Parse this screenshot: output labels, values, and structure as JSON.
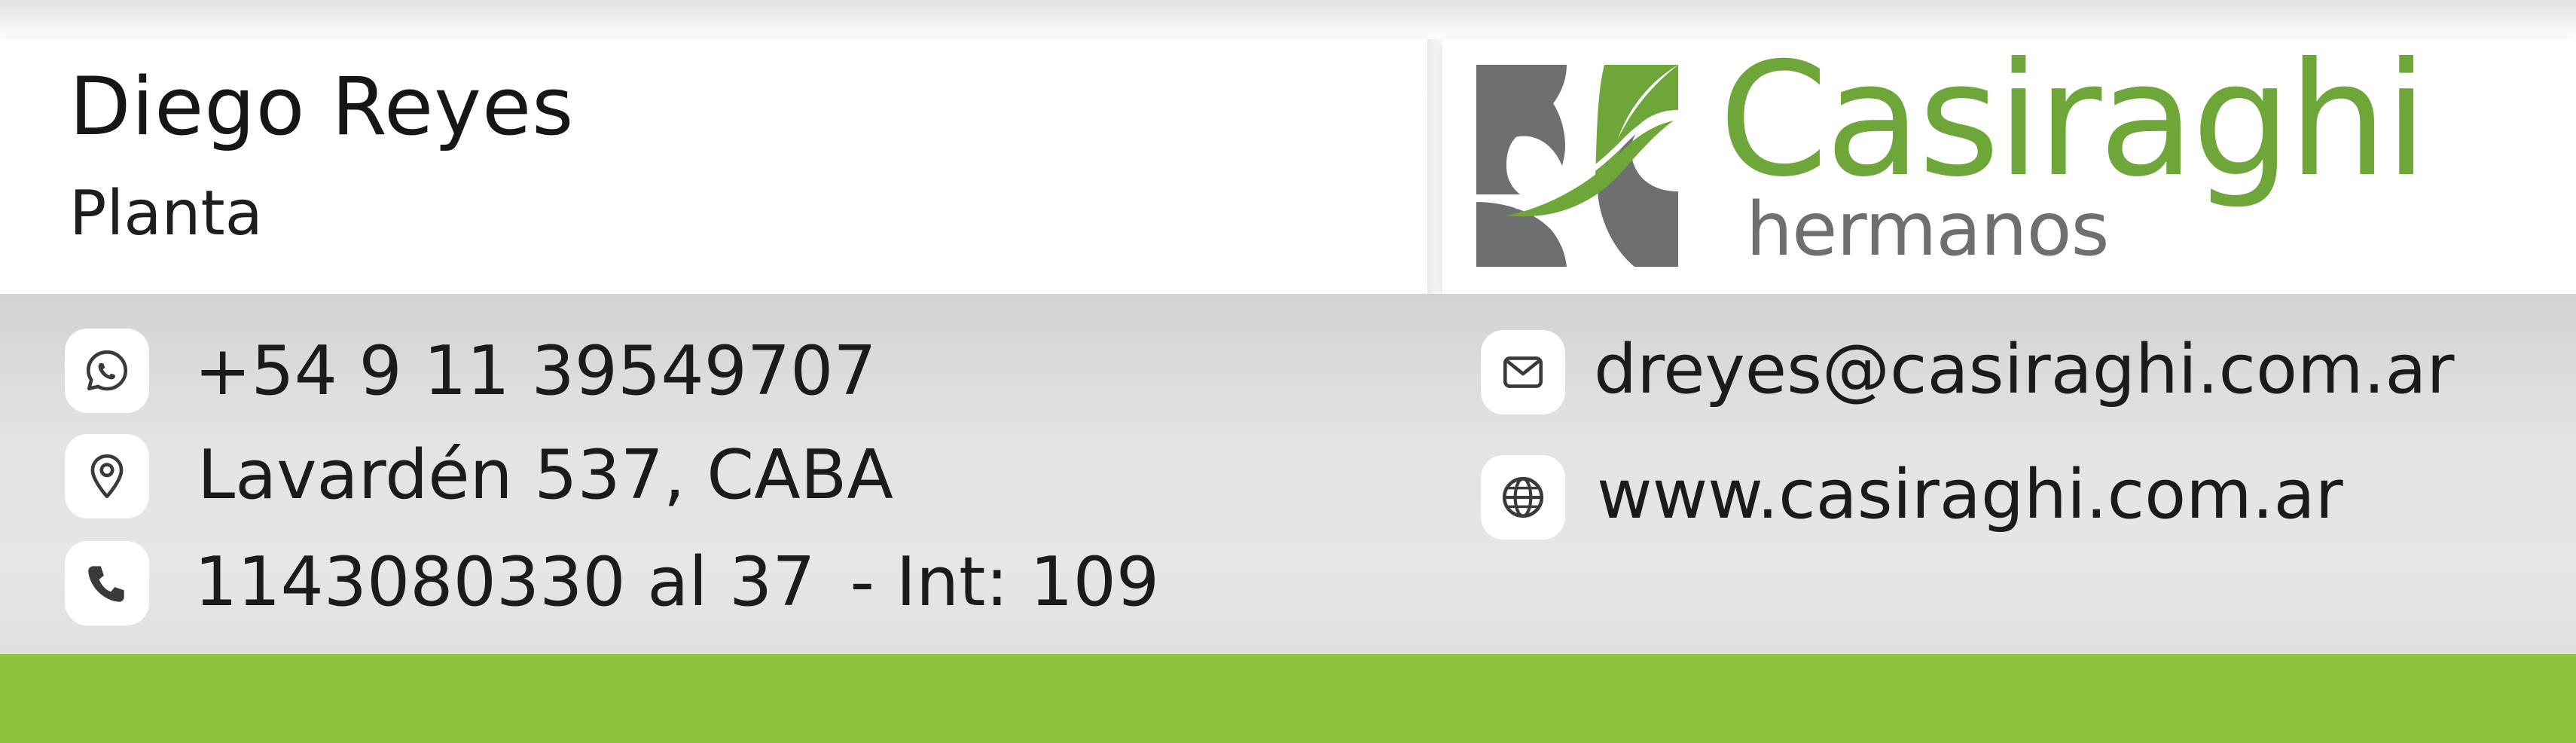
{
  "person": {
    "name": "Diego Reyes",
    "role": "Planta"
  },
  "company": {
    "name": "Casiraghi",
    "sub": "hermanos"
  },
  "contact": {
    "whatsapp": "+54 9 11 39549707",
    "address": "Lavardén 537, CABA",
    "phone": "1143080330 al 37",
    "extension": "- Int: 109",
    "email": "dreyes@casiraghi.com.ar",
    "website": "www.casiraghi.com.ar"
  },
  "icons": {
    "whatsapp": "whatsapp-icon",
    "location": "location-pin-icon",
    "phone": "phone-icon",
    "email": "envelope-icon",
    "web": "globe-icon"
  },
  "colors": {
    "brand_green": "#6fa63a",
    "footer_green": "#8cc43e",
    "logo_gray": "#6e6f71",
    "icon_gray": "#3a3a3a"
  }
}
